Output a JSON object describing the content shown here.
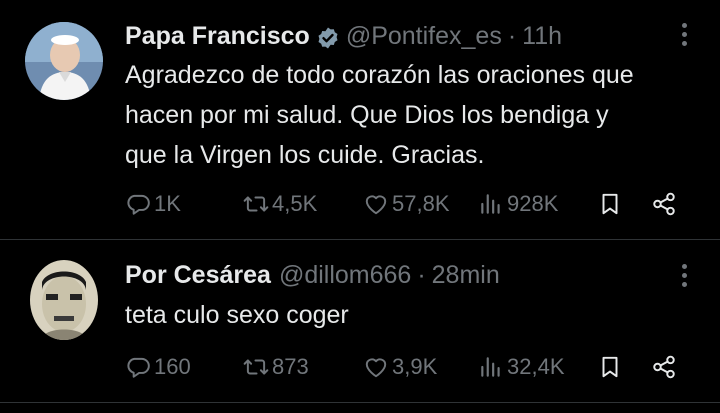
{
  "colors": {
    "background": "#000000",
    "primary_text": "#e7e9ea",
    "secondary_text": "#71767b",
    "divider": "#2f3336",
    "verified_badge": "#829aab"
  },
  "tweets": [
    {
      "author_name": "Papa Francisco",
      "verified": true,
      "handle": "@Pontifex_es",
      "separator": "·",
      "time": "11h",
      "text": "Agradezco de todo corazón las oraciones que\nhacen por mi salud. Que Dios los bendiga y\nque la Virgen los cuide. Gracias.",
      "actions": {
        "replies": "1K",
        "retweets": "4,5K",
        "likes": "57,8K",
        "views": "928K"
      },
      "icons": {
        "reply": "speech-bubble-icon",
        "retweet": "retweet-icon",
        "like": "heart-icon",
        "views": "bar-chart-icon",
        "bookmark": "bookmark-icon",
        "share": "share-icon",
        "more": "more-vertical-icon",
        "badge": "verified-badge-icon"
      }
    },
    {
      "author_name": "Por Cesárea",
      "verified": false,
      "handle": "@dillom666",
      "separator": "·",
      "time": "28min",
      "text": "teta culo sexo coger",
      "actions": {
        "replies": "160",
        "retweets": "873",
        "likes": "3,9K",
        "views": "32,4K"
      },
      "icons": {
        "reply": "speech-bubble-icon",
        "retweet": "retweet-icon",
        "like": "heart-icon",
        "views": "bar-chart-icon",
        "bookmark": "bookmark-icon",
        "share": "share-icon",
        "more": "more-vertical-icon"
      }
    }
  ]
}
